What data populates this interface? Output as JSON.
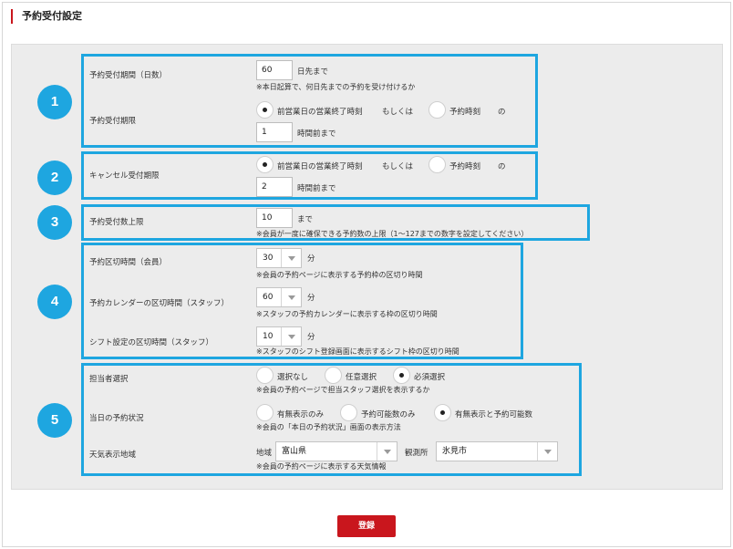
{
  "page": {
    "title": "予約受付設定",
    "submit_label": "登録"
  },
  "accent_color": "#1ea6e0",
  "brand_color": "#c9161d",
  "sections": [
    {
      "number": "1",
      "period_label": "予約受付期間（日数）",
      "period_value": "60",
      "period_suffix": "日先まで",
      "period_note": "※本日起算で、何日先までの予約を受け付けるか",
      "deadline_label": "予約受付期限",
      "opt_close": "前営業日の営業終了時刻",
      "or": "もしくは",
      "opt_time": "予約時刻",
      "no": "の",
      "hours_value": "1",
      "hours_suffix": "時間前まで"
    },
    {
      "number": "2",
      "label": "キャンセル受付期限",
      "opt_close": "前営業日の営業終了時刻",
      "or": "もしくは",
      "opt_time": "予約時刻",
      "no": "の",
      "hours_value": "2",
      "hours_suffix": "時間前まで"
    },
    {
      "number": "3",
      "label": "予約受付数上限",
      "value": "10",
      "suffix": "まで",
      "note": "※会員が一度に確保できる予約数の上限（1〜127までの数字を設定してください）"
    },
    {
      "number": "4",
      "rows": [
        {
          "label": "予約区切時間（会員）",
          "value": "30",
          "unit": "分",
          "note": "※会員の予約ページに表示する予約枠の区切り時間"
        },
        {
          "label": "予約カレンダーの区切時間（スタッフ）",
          "value": "60",
          "unit": "分",
          "note": "※スタッフの予約カレンダーに表示する枠の区切り時間"
        },
        {
          "label": "シフト設定の区切時間（スタッフ）",
          "value": "10",
          "unit": "分",
          "note": "※スタッフのシフト登録画面に表示するシフト枠の区切り時間"
        }
      ]
    },
    {
      "number": "5",
      "staff_label": "担当者選択",
      "staff_options": [
        "選択なし",
        "任意選択",
        "必須選択"
      ],
      "staff_note": "※会員の予約ページで担当スタッフ選択を表示するか",
      "status_label": "当日の予約状況",
      "status_options": [
        "有無表示のみ",
        "予約可能数のみ",
        "有無表示と予約可能数"
      ],
      "status_note": "※会員の「本日の予約状況」画面の表示方法",
      "weather_label": "天気表示地域",
      "region_label": "地域",
      "region_value": "富山県",
      "station_label": "観測所",
      "station_value": "氷見市",
      "weather_note": "※会員の予約ページに表示する天気情報"
    }
  ]
}
